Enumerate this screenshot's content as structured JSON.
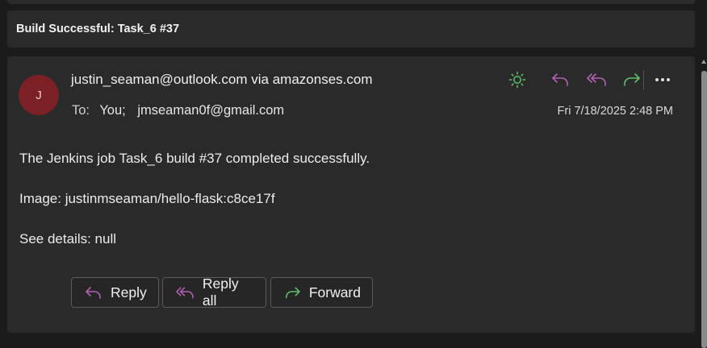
{
  "subject": "Build Successful: Task_6 #37",
  "message": {
    "avatar_initial": "J",
    "avatar_color": "#7b2126",
    "sender": "justin_seaman@outlook.com via amazonses.com",
    "to_label": "To:",
    "recipients": [
      "You;",
      "jmseaman0f@gmail.com"
    ],
    "date": "Fri 7/18/2025 2:48 PM",
    "body": [
      "The Jenkins job Task_6 build #37 completed successfully.",
      "Image: justinmseaman/hello-flask:c8ce17f",
      "See details: null"
    ]
  },
  "header_actions": [
    {
      "name": "sun-icon",
      "color": "#5fbf6a"
    },
    {
      "name": "reply-icon",
      "color": "#b35fb5"
    },
    {
      "name": "reply-all-icon",
      "color": "#b35fb5"
    },
    {
      "name": "forward-icon",
      "color": "#5fbf6a"
    },
    {
      "name": "more-options-icon",
      "color": "#e0e0e0"
    }
  ],
  "buttons": {
    "reply": "Reply",
    "reply_all": "Reply all",
    "forward": "Forward"
  },
  "colors": {
    "reply_accent": "#b35fb5",
    "forward_accent": "#5fbf6a"
  }
}
